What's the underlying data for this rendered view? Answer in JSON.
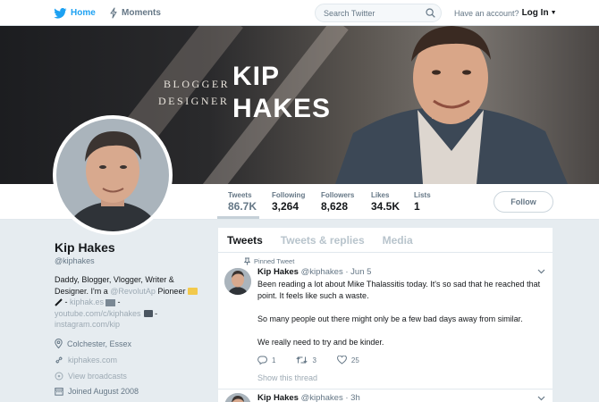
{
  "topbar": {
    "home_label": "Home",
    "moments_label": "Moments",
    "search_placeholder": "Search Twitter",
    "account_prompt": "Have an account?",
    "login_label": "Log In"
  },
  "banner": {
    "line1": "BLOGGER",
    "line2": "DESIGNER",
    "big1": "KIP",
    "big2": "HAKES"
  },
  "stats": [
    {
      "label": "Tweets",
      "value": "86.7K"
    },
    {
      "label": "Following",
      "value": "3,264"
    },
    {
      "label": "Followers",
      "value": "8,628"
    },
    {
      "label": "Likes",
      "value": "34.5K"
    },
    {
      "label": "Lists",
      "value": "1"
    }
  ],
  "follow_label": "Follow",
  "profile": {
    "name": "Kip Hakes",
    "handle": "@kiphakes",
    "bio_1": "Daddy, Blogger, Vlogger, Writer &",
    "bio_2a": "Designer. I'm a ",
    "bio_2b": "@RevolutAp",
    "bio_2c": " Pioneer ",
    "bio_3a": " - ",
    "bio_3b": "kiphak.es",
    "bio_3c": " -",
    "bio_4a": "youtube.com/c/kiphakes",
    "bio_4b": " -",
    "bio_5": "instagram.com/kip",
    "location": "Colchester, Essex",
    "website": "kiphakes.com",
    "broadcasts": "View broadcasts",
    "joined": "Joined August 2008"
  },
  "tabs": [
    "Tweets",
    "Tweets & replies",
    "Media"
  ],
  "tweets": [
    {
      "pinned_label": "Pinned Tweet",
      "name": "Kip Hakes",
      "meta": "@kiphakes · Jun 5",
      "text_1": "Been reading a lot about Mike Thalassitis today. It's so sad that he reached that point. It feels like such a waste.",
      "text_2": "So many people out there might only be a few bad days away from similar.",
      "text_3": "We really need to try and be kinder.",
      "replies": "1",
      "retweets": "3",
      "likes": "25",
      "show_thread": "Show this thread"
    },
    {
      "name": "Kip Hakes",
      "meta": "@kiphakes · 3h"
    }
  ],
  "colors": {
    "accent": "#1da1f2",
    "background": "#e6ecf0",
    "muted": "#657786"
  }
}
